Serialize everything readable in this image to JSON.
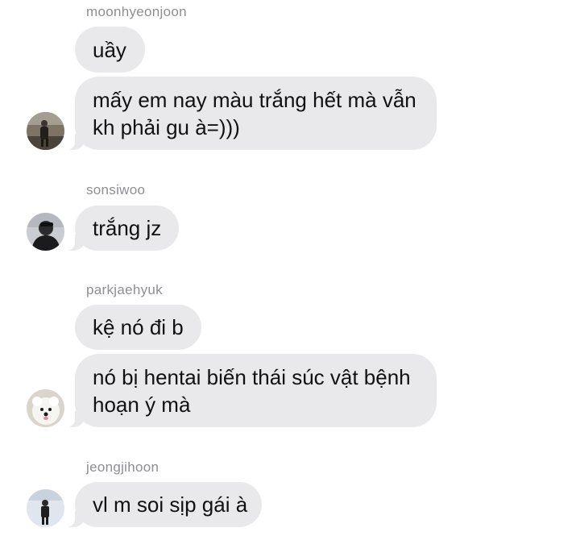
{
  "messages": [
    {
      "sender": "moonhyeonjoon",
      "avatar_icon": "person-avatar-icon",
      "bubbles": [
        {
          "lines": [
            "uầy"
          ]
        },
        {
          "lines": [
            "mấy em nay màu trắng hết mà vẫn",
            "kh phải gu à=)))"
          ]
        }
      ]
    },
    {
      "sender": "sonsiwoo",
      "avatar_icon": "person-avatar-icon",
      "bubbles": [
        {
          "lines": [
            "trắng jz"
          ]
        }
      ]
    },
    {
      "sender": "parkjaehyuk",
      "avatar_icon": "dog-avatar-icon",
      "bubbles": [
        {
          "lines": [
            "kệ nó đi b"
          ]
        },
        {
          "lines": [
            "nó bị hentai biến thái súc vật bệnh",
            "hoạn ý mà"
          ]
        }
      ]
    },
    {
      "sender": "jeongjihoon",
      "avatar_icon": "person-avatar-icon",
      "bubbles": [
        {
          "lines": [
            "vl m soi sịp gái à"
          ]
        }
      ]
    }
  ]
}
